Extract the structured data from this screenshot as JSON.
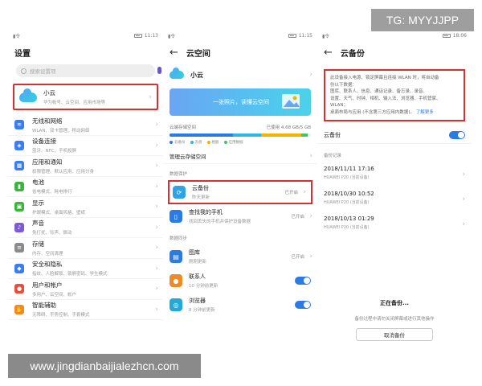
{
  "watermarks": {
    "tg": "TG: MYYJJPP",
    "site": "www.jingdianbaijialezhcn.com"
  },
  "colors": {
    "highlight": "#d9302f",
    "accent": "#2a7be4"
  },
  "panel1": {
    "status": {
      "carrier": "▮令",
      "time": "11:13"
    },
    "title": "设置",
    "search_placeholder": "搜索设置项",
    "cloud_item": {
      "label": "小云",
      "sub": "华为帐号、云空间、应用市场等"
    },
    "items": [
      {
        "label": "无线和网络",
        "sub": "WLAN、双卡管理、移动网络",
        "icon": "wifi-icon",
        "color": "blue"
      },
      {
        "label": "设备连接",
        "sub": "蓝牙、NFC、手机投屏",
        "icon": "device-connect-icon",
        "color": "blue"
      },
      {
        "label": "应用和通知",
        "sub": "权限管理、默认应用、应用分身",
        "icon": "apps-icon",
        "color": "orange"
      },
      {
        "label": "电池",
        "sub": "省电模式、耗电排行",
        "icon": "battery-icon",
        "color": "green"
      },
      {
        "label": "显示",
        "sub": "护眼模式、桌面风格、壁纸",
        "icon": "display-icon",
        "color": "green"
      },
      {
        "label": "声音",
        "sub": "免打扰、铃声、振动",
        "icon": "sound-icon",
        "color": "purple"
      },
      {
        "label": "存储",
        "sub": "内存、空间清理",
        "icon": "storage-icon",
        "color": "gray"
      },
      {
        "label": "安全和隐私",
        "sub": "指纹、人脸解锁、锁屏密码、学生模式",
        "icon": "security-icon",
        "color": "blue"
      },
      {
        "label": "用户和帐户",
        "sub": "多用户、云空间、帐户",
        "icon": "user-icon",
        "color": "red"
      },
      {
        "label": "智能辅助",
        "sub": "无障碍、手势控制、手套模式",
        "icon": "assist-icon",
        "color": "orange"
      }
    ]
  },
  "panel2": {
    "status": {
      "carrier": "▮令",
      "time": "11:15"
    },
    "title": "云空间",
    "account_name": "小云",
    "banner_text": "一张照片，读懂云空间",
    "storage": {
      "label": "云端存储空间",
      "usage": "已使用 4.68 GB/5 GB",
      "segments": [
        {
          "name": "云备份",
          "fraction": 0.45,
          "color": "#2a7be4"
        },
        {
          "name": "云盘",
          "fraction": 0.2,
          "color": "#2fb5e6"
        },
        {
          "name": "相册",
          "fraction": 0.28,
          "color": "#f0b400"
        },
        {
          "name": "应用数据",
          "fraction": 0.05,
          "color": "#46c26b"
        }
      ]
    },
    "manage": "管理云存储空间",
    "protect_label": "数据保护",
    "backup": {
      "label": "云备份",
      "sub": "昨天更新",
      "status": "已开启"
    },
    "findphone": {
      "label": "查找我的手机",
      "sub": "找回丢失的手机并保护设备数据",
      "status": "已开启"
    },
    "sync_label": "数据同步",
    "gallery": {
      "label": "图库",
      "sub": "刚刚更新",
      "status": "已开启"
    },
    "contacts": {
      "label": "联系人",
      "sub": "10 分钟前更新"
    },
    "browser": {
      "label": "浏览器",
      "sub": "8 分钟前更新"
    }
  },
  "panel3": {
    "status": {
      "carrier": "▮令",
      "time": "18:06"
    },
    "title": "云备份",
    "notice_lines": [
      "此设备接入电源、锁定屏幕且连接 WLAN 时，将自动备",
      "份以下数据：",
      "图库、联系人、信息、通话记录、备忘录、录音、",
      "设置、天气、时钟、相机、输入法、浏览器、手机管家、",
      "WLAN；",
      "桌面布局与应用 (不含第三方应用内数据)。"
    ],
    "learn_more": "了解更多",
    "toggle_label": "云备份",
    "records_label": "备份记录",
    "records": [
      {
        "date": "2018/11/11 17:16",
        "device": "HUAWEI P20 (当前设备)"
      },
      {
        "date": "2018/10/30 10:52",
        "device": "HUAWEI P20 (当前设备)"
      },
      {
        "date": "2018/10/13 01:29",
        "device": "HUAWEI P20 (当前设备)"
      }
    ],
    "backing_title": "正在备份...",
    "backing_tip": "备份过程中请勿关闭屏幕或进行其他操作",
    "cancel": "取消备份"
  }
}
